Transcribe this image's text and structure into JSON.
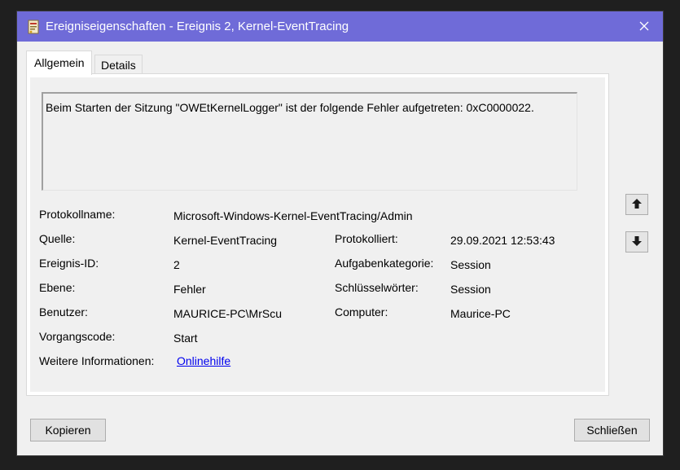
{
  "window": {
    "title": "Ereigniseigenschaften - Ereignis 2, Kernel-EventTracing"
  },
  "tabs": [
    {
      "label": "Allgemein",
      "active": true
    },
    {
      "label": "Details",
      "active": false
    }
  ],
  "message": "Beim Starten der Sitzung \"OWEtKernelLogger\" ist der folgende Fehler aufgetreten: 0xC0000022.",
  "fields": {
    "protokollname": {
      "label": "Protokollname:",
      "value": "Microsoft-Windows-Kernel-EventTracing/Admin"
    },
    "quelle": {
      "label": "Quelle:",
      "value": "Kernel-EventTracing"
    },
    "protokolliert": {
      "label": "Protokolliert:",
      "value": "29.09.2021 12:53:43"
    },
    "ereignis_id": {
      "label": "Ereignis-ID:",
      "value": "2"
    },
    "aufgabenkategorie": {
      "label": "Aufgabenkategorie:",
      "value": "Session"
    },
    "ebene": {
      "label": "Ebene:",
      "value": "Fehler"
    },
    "schluesselwoerter": {
      "label": "Schlüsselwörter:",
      "value": "Session"
    },
    "benutzer": {
      "label": "Benutzer:",
      "value": "MAURICE-PC\\MrScu"
    },
    "computer": {
      "label": "Computer:",
      "value": "Maurice-PC"
    },
    "vorgangscode": {
      "label": "Vorgangscode:",
      "value": "Start"
    },
    "weitere_informationen": {
      "label": "Weitere Informationen:",
      "value": "Onlinehilfe"
    }
  },
  "buttons": {
    "copy": "Kopieren",
    "close": "Schließen"
  },
  "icons": {
    "up": "arrow-up-icon",
    "down": "arrow-down-icon",
    "app": "event-viewer-icon",
    "close": "close-icon"
  },
  "colors": {
    "titlebar": "#6f6bd8",
    "link": "#0000ee"
  }
}
